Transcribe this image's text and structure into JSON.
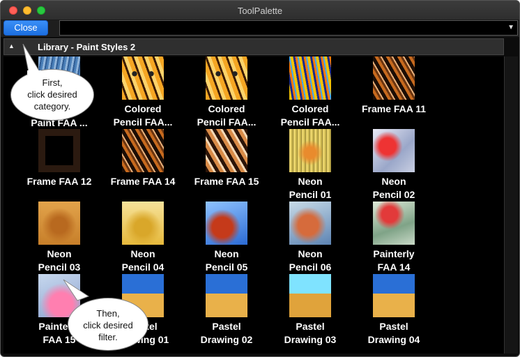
{
  "window": {
    "title": "ToolPalette"
  },
  "toolbar": {
    "close_label": "Close",
    "search_value": ""
  },
  "library": {
    "title": "Library - Paint Styles 2"
  },
  "tiles": [
    {
      "line1": "Paint FAA ...",
      "line2": "",
      "style": "blue-lines"
    },
    {
      "line1": "Colored",
      "line2": "Pencil FAA...",
      "style": "tiger-warm"
    },
    {
      "line1": "Colored",
      "line2": "Pencil FAA...",
      "style": "tiger-warm"
    },
    {
      "line1": "Colored",
      "line2": "Pencil FAA...",
      "style": "tiger-colorful"
    },
    {
      "line1": "Frame FAA 11",
      "line2": "",
      "style": "tiger-dark"
    },
    {
      "line1": "Frame FAA 12",
      "line2": "",
      "style": "tiger-framed"
    },
    {
      "line1": "Frame FAA 14",
      "line2": "",
      "style": "tiger-dark"
    },
    {
      "line1": "Frame FAA 15",
      "line2": "",
      "style": "tiger-framed-light"
    },
    {
      "line1": "Neon",
      "line2": "Pencil 01",
      "style": "neon-yellow"
    },
    {
      "line1": "Neon",
      "line2": "Pencil 02",
      "style": "flower-red"
    },
    {
      "line1": "Neon",
      "line2": "Pencil 03",
      "style": "lion-orange"
    },
    {
      "line1": "Neon",
      "line2": "Pencil 04",
      "style": "lion-yellow"
    },
    {
      "line1": "Neon",
      "line2": "Pencil 05",
      "style": "fox-blue"
    },
    {
      "line1": "Neon",
      "line2": "Pencil 06",
      "style": "fox-blur"
    },
    {
      "line1": "Painterly",
      "line2": "FAA 14",
      "style": "flower-pastel"
    },
    {
      "line1": "Painterly",
      "line2": "FAA 15",
      "style": "pink-blue"
    },
    {
      "line1": "Pastel",
      "line2": "Drawing 01",
      "style": "wheat-sky"
    },
    {
      "line1": "Pastel",
      "line2": "Drawing 02",
      "style": "wheat-sky"
    },
    {
      "line1": "Pastel",
      "line2": "Drawing 03",
      "style": "wheat-cyan"
    },
    {
      "line1": "Pastel",
      "line2": "Drawing 04",
      "style": "wheat-sky"
    }
  ],
  "callouts": [
    {
      "line1": "First,",
      "line2": "click desired",
      "line3": "category."
    },
    {
      "line1": "Then,",
      "line2": "click desired",
      "line3": "filter."
    }
  ]
}
